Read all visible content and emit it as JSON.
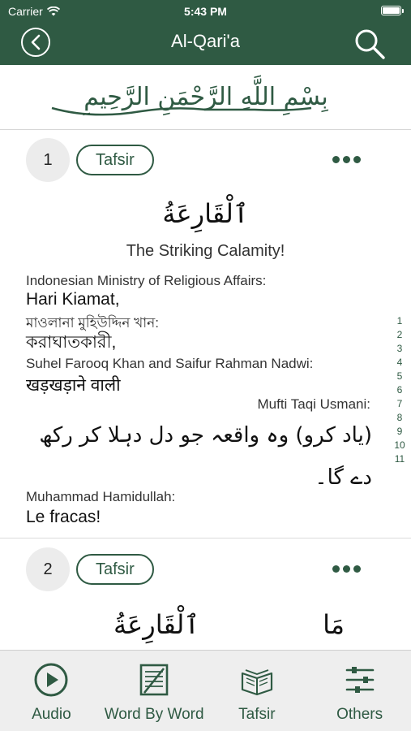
{
  "status": {
    "carrier": "Carrier",
    "time": "5:43 PM"
  },
  "nav": {
    "title": "Al-Qari'a"
  },
  "bismillah": {
    "text": "بِسْمِ اللَّهِ الرَّحْمَنِ الرَّحِيمِ"
  },
  "ayahs": [
    {
      "number": "1",
      "tafsir_label": "Tafsir",
      "arabic": "ٱلْقَارِعَةُ",
      "title": "The Striking Calamity!",
      "translations": [
        {
          "translator": "Indonesian Ministry of Religious Affairs:",
          "text": "Hari Kiamat,"
        },
        {
          "translator": "মাওলানা মুহিউদ্দিন খান:",
          "text": "করাঘাতকারী,"
        },
        {
          "translator": "Suhel Farooq Khan and Saifur Rahman Nadwi:",
          "text": "खड़खड़ाने वाली"
        },
        {
          "translator": "Mufti Taqi Usmani:",
          "text": "(یاد کرو) وہ واقعہ جو دل دہلا کر رکھ دے گا۔"
        },
        {
          "translator": "Muhammad Hamidullah:",
          "text": "Le fracas!"
        }
      ]
    },
    {
      "number": "2",
      "tafsir_label": "Tafsir",
      "arabic_words": [
        "مَا",
        "ٱلْقَارِعَةُ"
      ]
    }
  ],
  "side_index": [
    "1",
    "2",
    "3",
    "4",
    "5",
    "6",
    "7",
    "8",
    "9",
    "10",
    "11"
  ],
  "tabs": [
    {
      "label": "Audio",
      "icon": "play-circle-icon"
    },
    {
      "label": "Word By Word",
      "icon": "word-book-icon"
    },
    {
      "label": "Tafsir",
      "icon": "open-book-icon"
    },
    {
      "label": "Others",
      "icon": "sliders-icon"
    }
  ],
  "colors": {
    "primary": "#2f5a43",
    "tabbar_bg": "#eeeeee",
    "number_bg": "#ececec"
  }
}
